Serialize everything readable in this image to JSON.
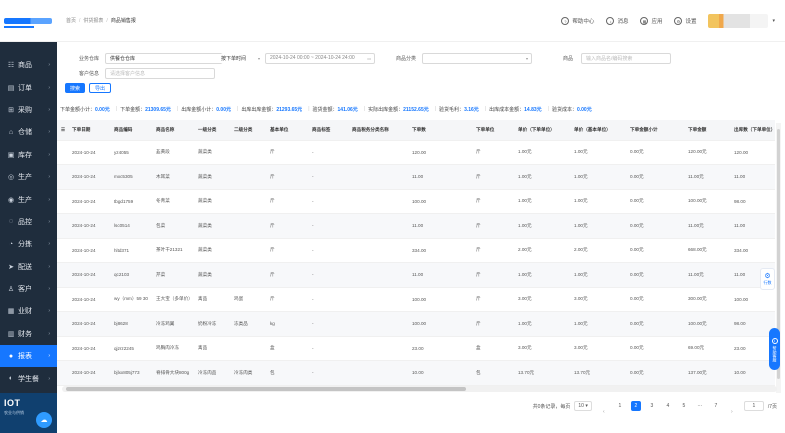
{
  "sidebar": {
    "items": [
      {
        "icon": "☷",
        "label": "商品",
        "active": false
      },
      {
        "icon": "▤",
        "label": "订单",
        "active": false
      },
      {
        "icon": "⊞",
        "label": "采购",
        "active": false
      },
      {
        "icon": "⌂",
        "label": "仓储",
        "active": false
      },
      {
        "icon": "▣",
        "label": "库存",
        "active": false
      },
      {
        "icon": "◎",
        "label": "生产",
        "active": false
      },
      {
        "icon": "◉",
        "label": "生产",
        "active": false
      },
      {
        "icon": "◌",
        "label": "品控",
        "active": false
      },
      {
        "icon": "◔",
        "label": "分拣",
        "active": false
      },
      {
        "icon": "➤",
        "label": "配送",
        "active": false
      },
      {
        "icon": "♙",
        "label": "客户",
        "active": false
      },
      {
        "icon": "▦",
        "label": "业财",
        "active": false
      },
      {
        "icon": "▥",
        "label": "财务",
        "active": false
      },
      {
        "icon": "●",
        "label": "报表",
        "active": true
      },
      {
        "icon": "◐",
        "label": "学生餐",
        "active": false
      }
    ],
    "iot_title": "IOT",
    "iot_sub": "农业与供销"
  },
  "header": {
    "breadcrumb": [
      "首页",
      "供货报表",
      "商品销售报"
    ],
    "links": [
      {
        "icon": "?",
        "label": "帮助中心"
      },
      {
        "icon": "♪",
        "label": "消息"
      },
      {
        "icon": "▦",
        "label": "应用"
      },
      {
        "icon": "⚙",
        "label": "设置"
      }
    ]
  },
  "filters": {
    "warehouse_label": "业务仓库",
    "warehouse_value": "供餐仓仓库",
    "date_type_value": "按下单时间",
    "date_range_value": "2024-10-24 00:00 ~ 2024-10-24 24:00",
    "category_label": "商品分类",
    "category_placeholder": "",
    "product_label": "商品",
    "product_placeholder": "输入商品名/编码搜索",
    "customer_label": "客户信息",
    "customer_placeholder": "请选择客户信息",
    "search_btn": "搜索",
    "export_btn": "导出"
  },
  "summary": [
    {
      "label": "下单金额小计：",
      "value": "0.00元"
    },
    {
      "label": "下单金额：",
      "value": "21309.65元"
    },
    {
      "label": "出库金额小计：",
      "value": "0.00元"
    },
    {
      "label": "出库出库金额：",
      "value": "21293.65元"
    },
    {
      "label": "验货金额：",
      "value": "141.06元"
    },
    {
      "label": "实际出库金额：",
      "value": "21152.65元"
    },
    {
      "label": "验货毛利：",
      "value": "3.16元"
    },
    {
      "label": "出库成本金额：",
      "value": "14.83元"
    },
    {
      "label": "验货成本：",
      "value": "0.00元"
    }
  ],
  "table": {
    "columns": [
      "",
      "下单日期",
      "商品编码",
      "商品名称",
      "一级分类",
      "二级分类",
      "基本单位",
      "商品标签",
      "商品税务分类名称",
      "下单数",
      "下单单位",
      "单价（下单单位）",
      "单价（基本单位）",
      "下单金额小计",
      "下单金额",
      "出库数（下单单位）"
    ],
    "rows": [
      [
        "",
        "2024-10-24",
        "yz4055",
        "韭黄段",
        "蔬菜类",
        "",
        "斤",
        "-",
        "",
        "120.00",
        "斤",
        "1.00元",
        "1.00元",
        "0.00元",
        "120.00元",
        "120.00"
      ],
      [
        "",
        "2024-10-24",
        "mxc5305",
        "木耳菜",
        "蔬菜类",
        "",
        "斤",
        "-",
        "",
        "11.00",
        "斤",
        "1.00元",
        "1.00元",
        "0.00元",
        "11.00元",
        "11.00"
      ],
      [
        "",
        "2024-10-24",
        "tbgd1759",
        "冬青菜",
        "蔬菜类",
        "",
        "斤",
        "-",
        "",
        "100.00",
        "斤",
        "1.00元",
        "1.00元",
        "0.00元",
        "100.00元",
        "98.00"
      ],
      [
        "",
        "2024-10-24",
        "lsc0514",
        "包菜",
        "蔬菜类",
        "",
        "斤",
        "-",
        "",
        "11.00",
        "斤",
        "1.00元",
        "1.00元",
        "0.00元",
        "11.00元",
        "11.00"
      ],
      [
        "",
        "2024-10-24",
        "hltd371",
        "茶叶干21321",
        "蔬菜类",
        "",
        "斤",
        "-",
        "",
        "334.00",
        "斤",
        "2.00元",
        "2.00元",
        "0.00元",
        "668.00元",
        "334.00"
      ],
      [
        "",
        "2024-10-24",
        "qc2103",
        "芹菜",
        "蔬菜类",
        "",
        "斤",
        "-",
        "",
        "11.00",
        "斤",
        "1.00元",
        "1.00元",
        "0.00元",
        "11.00元",
        "11.00"
      ],
      [
        "",
        "2024-10-24",
        "wy（mm）59 30",
        "王大宝（多单价）",
        "禽品",
        "鸡蛋",
        "斤",
        "-",
        "",
        "100.00",
        "斤",
        "3.00元",
        "3.00元",
        "0.00元",
        "300.00元",
        "100.00"
      ],
      [
        "",
        "2024-10-24",
        "bj8628",
        "冷冻鸡翼",
        "奶粉冷冻",
        "冻类品",
        "kg",
        "-",
        "",
        "100.00",
        "斤",
        "1.00元",
        "1.00元",
        "0.00元",
        "100.00元",
        "98.00"
      ],
      [
        "",
        "2024-10-24",
        "qjzrz2245",
        "鸡胸肉冷冻",
        "禽品",
        "",
        "盒",
        "-",
        "",
        "23.00",
        "盒",
        "3.00元",
        "3.00元",
        "0.00元",
        "69.00元",
        "23.00"
      ],
      [
        "",
        "2024-10-24",
        "bjlxx805j773",
        "脊排骨大块800g",
        "冷冻肉品",
        "冷冻肉类",
        "包",
        "-",
        "",
        "10.00",
        "包",
        "13.70元",
        "13.70元",
        "0.00元",
        "137.00元",
        "10.00"
      ]
    ]
  },
  "side_tools": {
    "tab_label": "行数",
    "float_label": "帮助客服"
  },
  "pagination": {
    "total_text": "共0条记录，每页",
    "page_size": "10",
    "pages": [
      "1",
      "2",
      "3",
      "4",
      "5",
      "···",
      "7"
    ],
    "active_page": "2",
    "prev": "‹",
    "next": "›",
    "goto_value": "1",
    "goto_suffix": "/7页"
  },
  "colors": {
    "accent": "#1677ff",
    "sidebar_bg": "#1f2d3d"
  }
}
